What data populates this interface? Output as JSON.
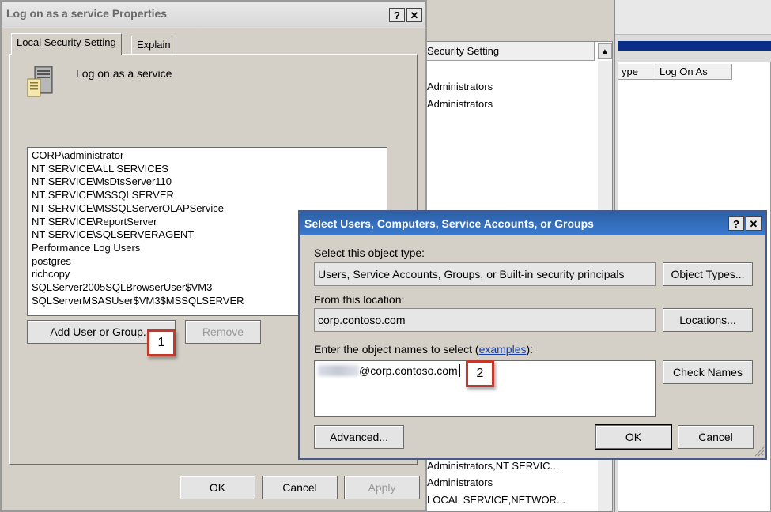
{
  "bg_window": {
    "columns": [
      "ype",
      "Log On As"
    ]
  },
  "policy_list": {
    "header": "Security Setting",
    "rows_top": [
      "Administrators",
      "Administrators"
    ],
    "rows_bottom": [
      "Administrators,NT SERVIC...",
      "Administrators",
      "LOCAL SERVICE,NETWOR..."
    ]
  },
  "props_dialog": {
    "title": "Log on as a service Properties",
    "help_glyph": "?",
    "close_glyph": "✕",
    "tabs": [
      "Local Security Setting",
      "Explain"
    ],
    "policy_name": "Log on as a service",
    "members": [
      "CORP\\administrator",
      "NT SERVICE\\ALL SERVICES",
      "NT SERVICE\\MsDtsServer110",
      "NT SERVICE\\MSSQLSERVER",
      "NT SERVICE\\MSSQLServerOLAPService",
      "NT SERVICE\\ReportServer",
      "NT SERVICE\\SQLSERVERAGENT",
      "Performance Log Users",
      "postgres",
      "richcopy",
      "SQLServer2005SQLBrowserUser$VM3",
      "SQLServerMSASUser$VM3$MSSQLSERVER"
    ],
    "add_button": "Add User or Group...",
    "remove_button": "Remove",
    "ok_button": "OK",
    "cancel_button": "Cancel",
    "apply_button": "Apply",
    "callout_1": "1"
  },
  "select_dialog": {
    "title": "Select Users, Computers, Service Accounts, or Groups",
    "help_glyph": "?",
    "close_glyph": "✕",
    "object_type_label": "Select this object type:",
    "object_type_value": "Users, Service Accounts, Groups, or Built-in security principals",
    "object_types_button": "Object Types...",
    "location_label": "From this location:",
    "location_value": "corp.contoso.com",
    "locations_button": "Locations...",
    "names_label_prefix": "Enter the object names to select (",
    "names_label_link": "examples",
    "names_label_suffix": "):",
    "names_value": "@corp.contoso.com",
    "check_names_button": "Check Names",
    "advanced_button": "Advanced...",
    "ok_button": "OK",
    "cancel_button": "Cancel",
    "callout_2": "2"
  },
  "icons": {
    "policy_icon": "server-policy-icon",
    "scroll_up": "▲"
  }
}
